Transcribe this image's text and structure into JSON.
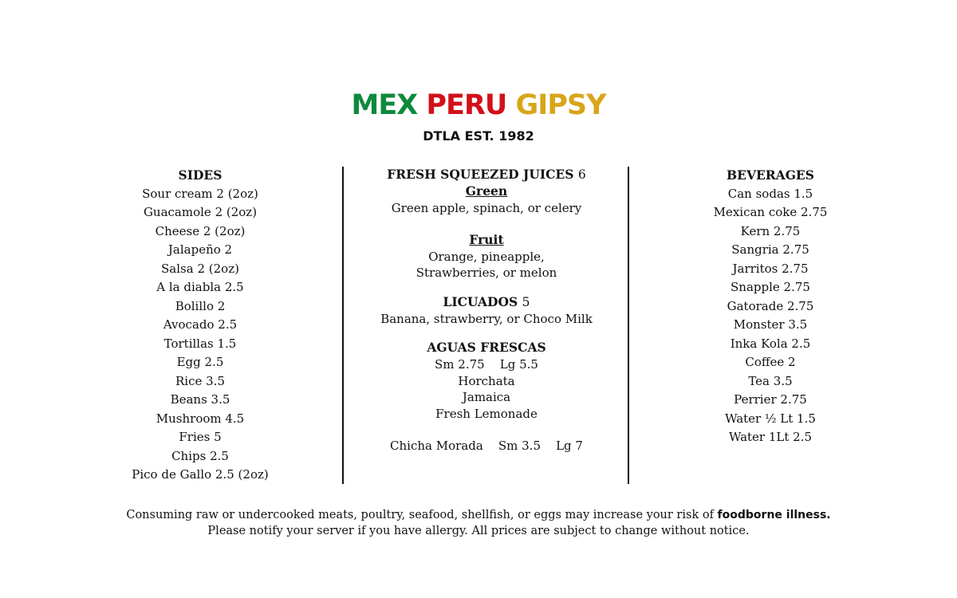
{
  "header": {
    "brand_word_1": "MEX",
    "brand_word_2": "PERU",
    "brand_word_3": "GIPSY",
    "brand_colors": [
      "#0d8a3c",
      "#d2101a",
      "#d8a51a"
    ],
    "subtitle": "DTLA EST. 1982"
  },
  "sides": {
    "title": "SIDES",
    "items": [
      "Sour cream 2 (2oz)",
      "Guacamole 2 (2oz)",
      "Cheese 2 (2oz)",
      "Jalapeño 2",
      "Salsa 2 (2oz)",
      "A la diabla 2.5",
      "Bolillo 2",
      "Avocado 2.5",
      "Tortillas 1.5",
      "Egg 2.5",
      "Rice 3.5",
      "Beans 3.5",
      "Mushroom 4.5",
      "Fries 5",
      "Chips 2.5",
      "Pico de Gallo 2.5 (2oz)"
    ]
  },
  "middle": {
    "juices": {
      "title": "FRESH SQUEEZED JUICES",
      "price": "6",
      "green_label": "Green",
      "green_desc": "Green apple, spinach, or celery",
      "fruit_label": "Fruit",
      "fruit_desc_line1": "Orange, pineapple,",
      "fruit_desc_line2": "Strawberries, or melon"
    },
    "licuados": {
      "title": "LICUADOS",
      "price": "5",
      "desc": "Banana, strawberry, or Choco Milk"
    },
    "aguas": {
      "title": "AGUAS FRESCAS",
      "sizes": "Sm 2.75    Lg 5.5",
      "flavors": [
        "Horchata",
        "Jamaica",
        "Fresh Lemonade"
      ]
    },
    "chicha": "Chicha Morada    Sm 3.5    Lg 7"
  },
  "beverages": {
    "title": "BEVERAGES",
    "items": [
      "Can sodas 1.5",
      "Mexican coke 2.75",
      "Kern 2.75",
      "Sangria 2.75",
      "Jarritos 2.75",
      "Snapple 2.75",
      "Gatorade 2.75",
      "Monster 3.5",
      "Inka Kola 2.5",
      "Coffee 2",
      "Tea 3.5",
      "Perrier 2.75",
      "Water ½ Lt 1.5",
      "Water 1Lt 2.5"
    ]
  },
  "footer": {
    "line1": "Consuming raw or undercooked meats, poultry, seafood, shellfish, or eggs may increase your risk of",
    "line1_bold": "foodborne illness.",
    "line2": "Please notify your server if you have allergy. All prices are subject to change without notice."
  }
}
